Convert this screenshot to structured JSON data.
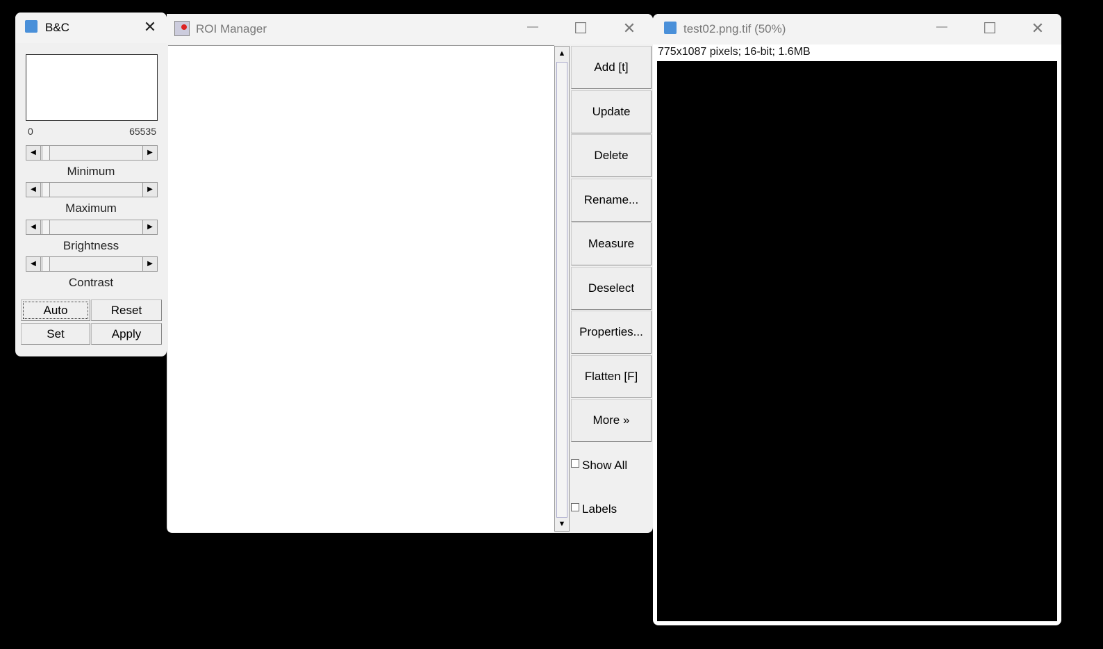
{
  "bc": {
    "title": "B&C",
    "min_label": "0",
    "max_label": "65535",
    "sliders": [
      "Minimum",
      "Maximum",
      "Brightness",
      "Contrast"
    ],
    "buttons": {
      "auto": "Auto",
      "reset": "Reset",
      "set": "Set",
      "apply": "Apply"
    }
  },
  "roi": {
    "title": "ROI Manager",
    "buttons": [
      "Add [t]",
      "Update",
      "Delete",
      "Rename...",
      "Measure",
      "Deselect",
      "Properties...",
      "Flatten [F]",
      "More »"
    ],
    "checkboxes": [
      "Show All",
      "Labels"
    ]
  },
  "image": {
    "title": "test02.png.tif (50%)",
    "info": "775x1087 pixels; 16-bit; 1.6MB"
  },
  "controls": {
    "minimize": "—",
    "maximize": "☐",
    "close": "✕"
  }
}
